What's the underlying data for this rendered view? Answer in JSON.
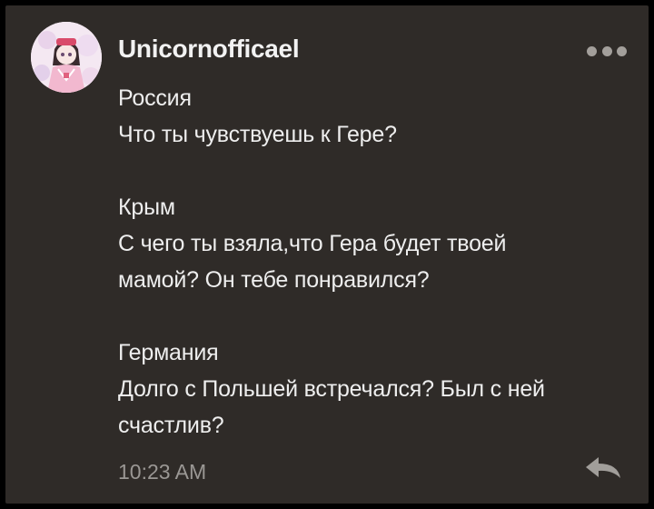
{
  "post": {
    "author": "Unicornofficael",
    "timestamp": "10:23 AM",
    "paragraphs": [
      {
        "lines": [
          "Россия",
          "Что ты чувствуешь к Гере?"
        ]
      },
      {
        "lines": [
          "Крым",
          "С чего ты взяла,что Гера будет твоей",
          "мамой? Он тебе понравился?"
        ]
      },
      {
        "lines": [
          "Германия",
          "Долго с Польшей встречался? Был с ней",
          "счастлив?"
        ]
      }
    ]
  },
  "icons": {
    "more": "more-dots-icon",
    "reply": "reply-arrow-icon",
    "avatar": "user-avatar"
  },
  "colors": {
    "card_background": "#2f2b28",
    "text": "#eeeeee",
    "muted": "#9a9794"
  }
}
